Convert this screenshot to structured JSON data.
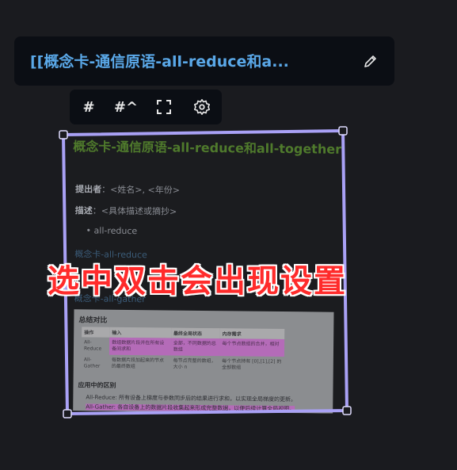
{
  "header": {
    "title": "[[概念卡-通信原语-all-reduce和a...",
    "edit_icon": "pencil-icon"
  },
  "toolbar": {
    "tag_label": "#",
    "heading_label": "#^",
    "fullscreen_icon": "expand-icon",
    "settings_icon": "gear-icon"
  },
  "note": {
    "title": "概念卡-通信原语-all-reduce和all-together",
    "proposer_label": "提出者",
    "proposer_value": "：<姓名>, <年份>",
    "desc_label": "描述",
    "desc_value": "：<具体描述或摘抄>",
    "bullet": "all-reduce",
    "link1": "概念卡-all-reduce",
    "link2": "概念卡-all-gather"
  },
  "embedded_table": {
    "heading": "总结对比",
    "columns": [
      "操作",
      "输入",
      "最终全局状态",
      "内存需求"
    ],
    "rows": [
      [
        "All-Reduce",
        "数组数据片段并在所有设备间求和",
        "全部，不同数据的总数组",
        "每个节点数组的合并，相对"
      ],
      [
        "All-Gather",
        "每数据片段加起来的节点的最终数组",
        "每节点完整的数组，大小 n",
        "每个节点持有 [0],[1],[2] 的全部数组"
      ]
    ],
    "subheading": "应用中的区别",
    "lines": [
      "All-Reduce: 所有设备上梯度与参数同步后的结果进行求和，以实现全局梯度的更新。",
      "All-Gather: 各自设备上的数据片段收集起来形成完整数据，以便后续计算全局视图。"
    ]
  },
  "overlay_caption": "选中双击会出现设置",
  "colors": {
    "title_link": "#5aa8e8",
    "selection_border": "#a9a1f5",
    "caption": "#ff2b2b"
  }
}
